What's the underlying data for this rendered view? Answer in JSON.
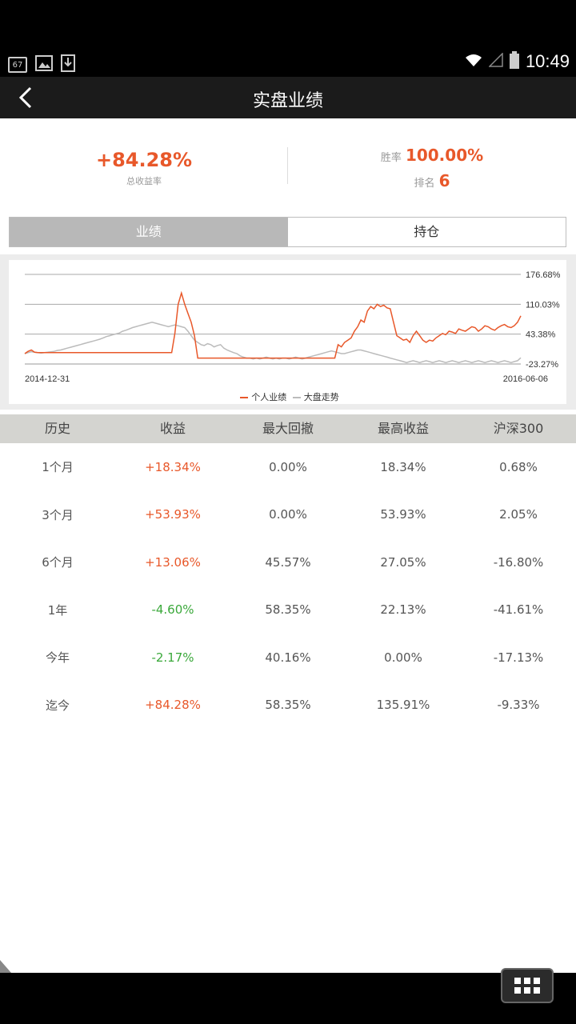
{
  "status_bar": {
    "notification_badge": "67",
    "time": "10:49"
  },
  "header": {
    "title": "实盘业绩"
  },
  "summary": {
    "total_return": "+84.28%",
    "total_return_label": "总收益率",
    "win_rate_label": "胜率",
    "win_rate": "100.00%",
    "rank_label": "排名",
    "rank": "6"
  },
  "tabs": [
    {
      "label": "业绩",
      "active": true
    },
    {
      "label": "持仓",
      "active": false
    }
  ],
  "chart_data": {
    "type": "line",
    "x_start": "2014-12-31",
    "x_end": "2016-06-06",
    "y_ticks": [
      "176.68%",
      "110.03%",
      "43.38%",
      "-23.27%"
    ],
    "ylim": [
      -23.27,
      176.68
    ],
    "series": [
      {
        "name": "个人业绩",
        "color": "#e8582a",
        "values": [
          0,
          5,
          8,
          3,
          2,
          2,
          2,
          2,
          2,
          2,
          2,
          2,
          2,
          2,
          2,
          2,
          2,
          2,
          2,
          2,
          2,
          2,
          2,
          2,
          2,
          2,
          2,
          2,
          2,
          2,
          2,
          2,
          2,
          2,
          2,
          2,
          2,
          2,
          2,
          2,
          2,
          2,
          2,
          2,
          2,
          2,
          45,
          110,
          135,
          110,
          90,
          70,
          40,
          -10,
          -10,
          -10,
          -10,
          -10,
          -10,
          -10,
          -10,
          -10,
          -10,
          -10,
          -10,
          -10,
          -10,
          -10,
          -10,
          -10,
          -10,
          -10,
          -10,
          -10,
          -10,
          -10,
          -10,
          -10,
          -10,
          -10,
          -10,
          -10,
          -10,
          -10,
          -10,
          -10,
          -10,
          -10,
          -10,
          -10,
          -10,
          -10,
          -10,
          -10,
          -10,
          -10,
          20,
          15,
          25,
          30,
          35,
          50,
          60,
          75,
          70,
          95,
          105,
          100,
          110,
          105,
          108,
          102,
          100,
          70,
          40,
          35,
          30,
          32,
          25,
          40,
          50,
          40,
          30,
          25,
          30,
          28,
          35,
          40,
          45,
          42,
          50,
          48,
          45,
          55,
          52,
          50,
          55,
          60,
          58,
          50,
          55,
          62,
          60,
          55,
          52,
          58,
          62,
          65,
          60,
          58,
          62,
          70,
          84.28
        ]
      },
      {
        "name": "大盘走势",
        "color": "#bbbbbb",
        "values": [
          0,
          2,
          4,
          3,
          2,
          1,
          2,
          3,
          4,
          5,
          7,
          8,
          10,
          12,
          14,
          16,
          18,
          20,
          22,
          24,
          26,
          28,
          30,
          32,
          35,
          38,
          40,
          42,
          44,
          46,
          50,
          52,
          55,
          58,
          60,
          62,
          64,
          66,
          68,
          70,
          68,
          66,
          64,
          62,
          60,
          62,
          64,
          62,
          60,
          58,
          50,
          40,
          30,
          25,
          20,
          18,
          22,
          20,
          15,
          18,
          20,
          12,
          8,
          5,
          2,
          0,
          -5,
          -8,
          -10,
          -10,
          -12,
          -10,
          -12,
          -10,
          -8,
          -10,
          -12,
          -10,
          -12,
          -10,
          -10,
          -12,
          -10,
          -8,
          -10,
          -12,
          -10,
          -8,
          -6,
          -4,
          -2,
          0,
          2,
          4,
          6,
          4,
          2,
          0,
          0,
          2,
          4,
          6,
          8,
          8,
          6,
          4,
          2,
          0,
          -2,
          -4,
          -6,
          -8,
          -10,
          -12,
          -14,
          -16,
          -18,
          -20,
          -18,
          -16,
          -18,
          -20,
          -18,
          -16,
          -18,
          -20,
          -18,
          -16,
          -18,
          -20,
          -18,
          -16,
          -18,
          -20,
          -18,
          -16,
          -18,
          -20,
          -18,
          -16,
          -18,
          -20,
          -18,
          -16,
          -18,
          -20,
          -18,
          -16,
          -18,
          -20,
          -18,
          -16,
          -9.33
        ]
      }
    ]
  },
  "legend": {
    "personal": "个人业绩",
    "market": "大盘走势"
  },
  "table": {
    "headers": [
      "历史",
      "收益",
      "最大回撤",
      "最高收益",
      "沪深300"
    ],
    "rows": [
      {
        "period": "1个月",
        "return": "+18.34%",
        "max_drawdown": "0.00%",
        "max_return": "18.34%",
        "hs300": "0.68%",
        "sign": "pos"
      },
      {
        "period": "3个月",
        "return": "+53.93%",
        "max_drawdown": "0.00%",
        "max_return": "53.93%",
        "hs300": "2.05%",
        "sign": "pos"
      },
      {
        "period": "6个月",
        "return": "+13.06%",
        "max_drawdown": "45.57%",
        "max_return": "27.05%",
        "hs300": "-16.80%",
        "sign": "pos"
      },
      {
        "period": "1年",
        "return": "-4.60%",
        "max_drawdown": "58.35%",
        "max_return": "22.13%",
        "hs300": "-41.61%",
        "sign": "neg"
      },
      {
        "period": "今年",
        "return": "-2.17%",
        "max_drawdown": "40.16%",
        "max_return": "0.00%",
        "hs300": "-17.13%",
        "sign": "neg"
      },
      {
        "period": "迄今",
        "return": "+84.28%",
        "max_drawdown": "58.35%",
        "max_return": "135.91%",
        "hs300": "-9.33%",
        "sign": "pos"
      }
    ]
  }
}
